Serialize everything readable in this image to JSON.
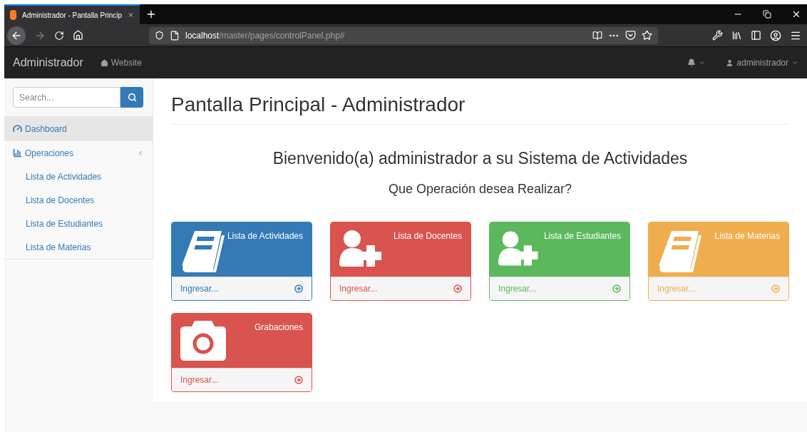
{
  "browser": {
    "tab_title": "Administrador - Pantalla Princip",
    "url_host": "localhost",
    "url_path": "/master/pages/controlPanel.php#"
  },
  "navbar": {
    "brand": "Administrador",
    "website_link": "Website",
    "user": "administrador"
  },
  "sidebar": {
    "search": {
      "placeholder": "Search..."
    },
    "items": [
      {
        "label": "Dashboard",
        "kind": "dashboard",
        "selected": true
      },
      {
        "label": "Operaciones",
        "kind": "chart",
        "selected": false,
        "expanded": true,
        "children": [
          {
            "label": "Lista de Actividades"
          },
          {
            "label": "Lista de Docentes"
          },
          {
            "label": "Lista de Estudiantes"
          },
          {
            "label": "Lista de Materias"
          }
        ]
      }
    ]
  },
  "page_title": "Pantalla Principal - Administrador",
  "welcome": "Bienvenido(a) administrador a su Sistema de Actividades",
  "question": "Que Operación desea Realizar?",
  "cards": [
    {
      "title": "Lista de Actividades",
      "kind": "book",
      "color": "#337ab7",
      "link": "Ingresar..."
    },
    {
      "title": "Lista de Docentes",
      "kind": "user-plus",
      "color": "#d9534f",
      "link": "Ingresar..."
    },
    {
      "title": "Lista de Estudiantes",
      "kind": "user-plus",
      "color": "#5cb85c",
      "link": "Ingresar..."
    },
    {
      "title": "Lista de Materias",
      "kind": "book",
      "color": "#f0ad4e",
      "link": "Ingresar..."
    },
    {
      "title": "Grabaciones",
      "kind": "camera",
      "color": "#d9534f",
      "link": "Ingresar..."
    }
  ]
}
